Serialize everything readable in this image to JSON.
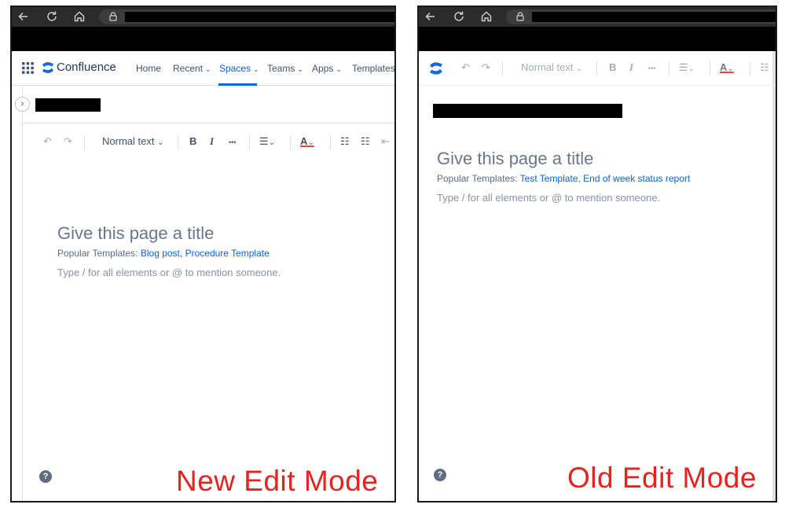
{
  "new_mode": {
    "nav": {
      "brand": "Confluence",
      "items": [
        {
          "label": "Home",
          "chevron": false
        },
        {
          "label": "Recent",
          "chevron": true
        },
        {
          "label": "Spaces",
          "chevron": true,
          "active": true
        },
        {
          "label": "Teams",
          "chevron": true
        },
        {
          "label": "Apps",
          "chevron": true
        },
        {
          "label": "Templates",
          "chevron": false
        }
      ],
      "chevron_glyph": "⌄"
    },
    "toolbar": {
      "undo": "↶",
      "redo": "↷",
      "text_style": "Normal text",
      "dropdown_chevron": "⌄",
      "bold": "B",
      "italic": "I",
      "more": "•••",
      "align": "☰",
      "text_color": "A",
      "bullets": "☷",
      "numbers": "☷",
      "indent": "⇤"
    },
    "editor": {
      "title_placeholder": "Give this page a title",
      "templates_prefix": "Popular Templates:",
      "templates": [
        "Blog post",
        "Procedure Template"
      ],
      "hint": "Type / for all elements or @ to mention someone."
    },
    "help": "?",
    "label": "New Edit Mode"
  },
  "old_mode": {
    "toolbar": {
      "undo": "↶",
      "redo": "↷",
      "text_style": "Normal text",
      "dropdown_chevron": "⌄",
      "bold": "B",
      "italic": "I",
      "more": "•••",
      "align": "☰",
      "text_color": "A",
      "bullets": "☷"
    },
    "editor": {
      "title_placeholder": "Give this page a title",
      "templates_prefix": "Popular Templates:",
      "templates": [
        "Test Template",
        "End of week status report"
      ],
      "hint": "Type / for all elements or @ to mention someone."
    },
    "help": "?",
    "label": "Old Edit Mode"
  },
  "colors": {
    "accent": "#0c66e4",
    "label_red": "#e8221f",
    "browser_bar": "#2b2b2b",
    "confluence_blue": "#1868db"
  },
  "icons": [
    "back-arrow-icon",
    "reload-icon",
    "home-icon",
    "lock-icon",
    "app-grid-icon",
    "confluence-logo-icon",
    "help-icon",
    "expand-chevron-icon"
  ]
}
